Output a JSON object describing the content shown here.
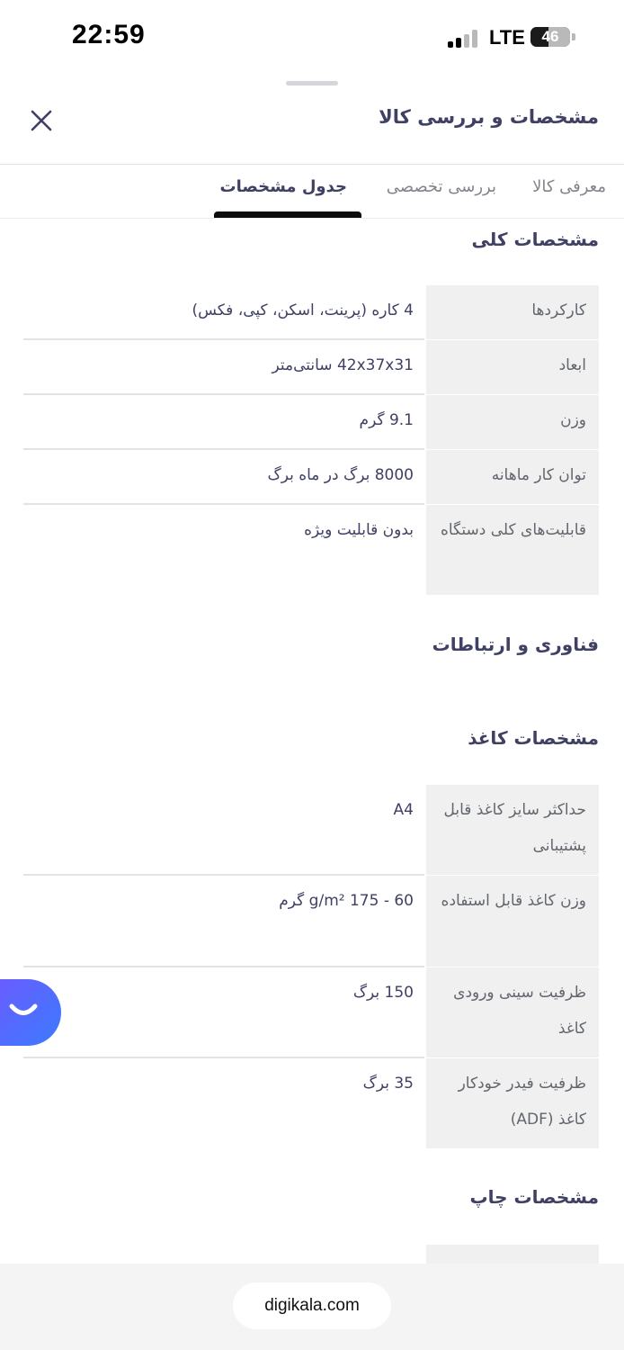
{
  "status_bar": {
    "time": "22:59",
    "network": "LTE",
    "battery": "46"
  },
  "header": {
    "title": "مشخصات و بررسی کالا"
  },
  "tabs": [
    {
      "label": "معرفی کالا",
      "active": false
    },
    {
      "label": "بررسی تخصصی",
      "active": false
    },
    {
      "label": "جدول مشخصات",
      "active": true
    }
  ],
  "sections": {
    "general": {
      "title": "مشخصات کلی",
      "rows": [
        {
          "key": "کارکردها",
          "value": "4 کاره (پرینت، اسکن، کپی، فکس)"
        },
        {
          "key": "ابعاد",
          "value": "42x37x31 سانتی‌متر"
        },
        {
          "key": "وزن",
          "value": "9.1 گرم"
        },
        {
          "key": "توان کار ماهانه",
          "value": "8000 برگ در ماه برگ"
        },
        {
          "key": "قابلیت‌های کلی دستگاه",
          "value": "بدون قابلیت ویژه"
        }
      ]
    },
    "tech": {
      "title": "فناوری و ارتباطات"
    },
    "paper": {
      "title": "مشخصات کاغذ",
      "rows": [
        {
          "key": "حداکثر سایز کاغذ قابل پشتیبانی",
          "value": "A4"
        },
        {
          "key": "وزن کاغذ قابل استفاده",
          "value": "g/m² 175 - 60 گرم"
        },
        {
          "key": "ظرفیت سینی ورودی کاغذ",
          "value": "150 برگ"
        },
        {
          "key": "ظرفیت فیدر خودکار کاغذ (ADF)",
          "value": "35 برگ"
        }
      ]
    },
    "print": {
      "title": "مشخصات چاپ"
    }
  },
  "browser": {
    "url": "digikala.com"
  },
  "colors": {
    "accent": "#3b7bff",
    "text": "#3f4064",
    "key_bg": "#f0f0f1"
  }
}
